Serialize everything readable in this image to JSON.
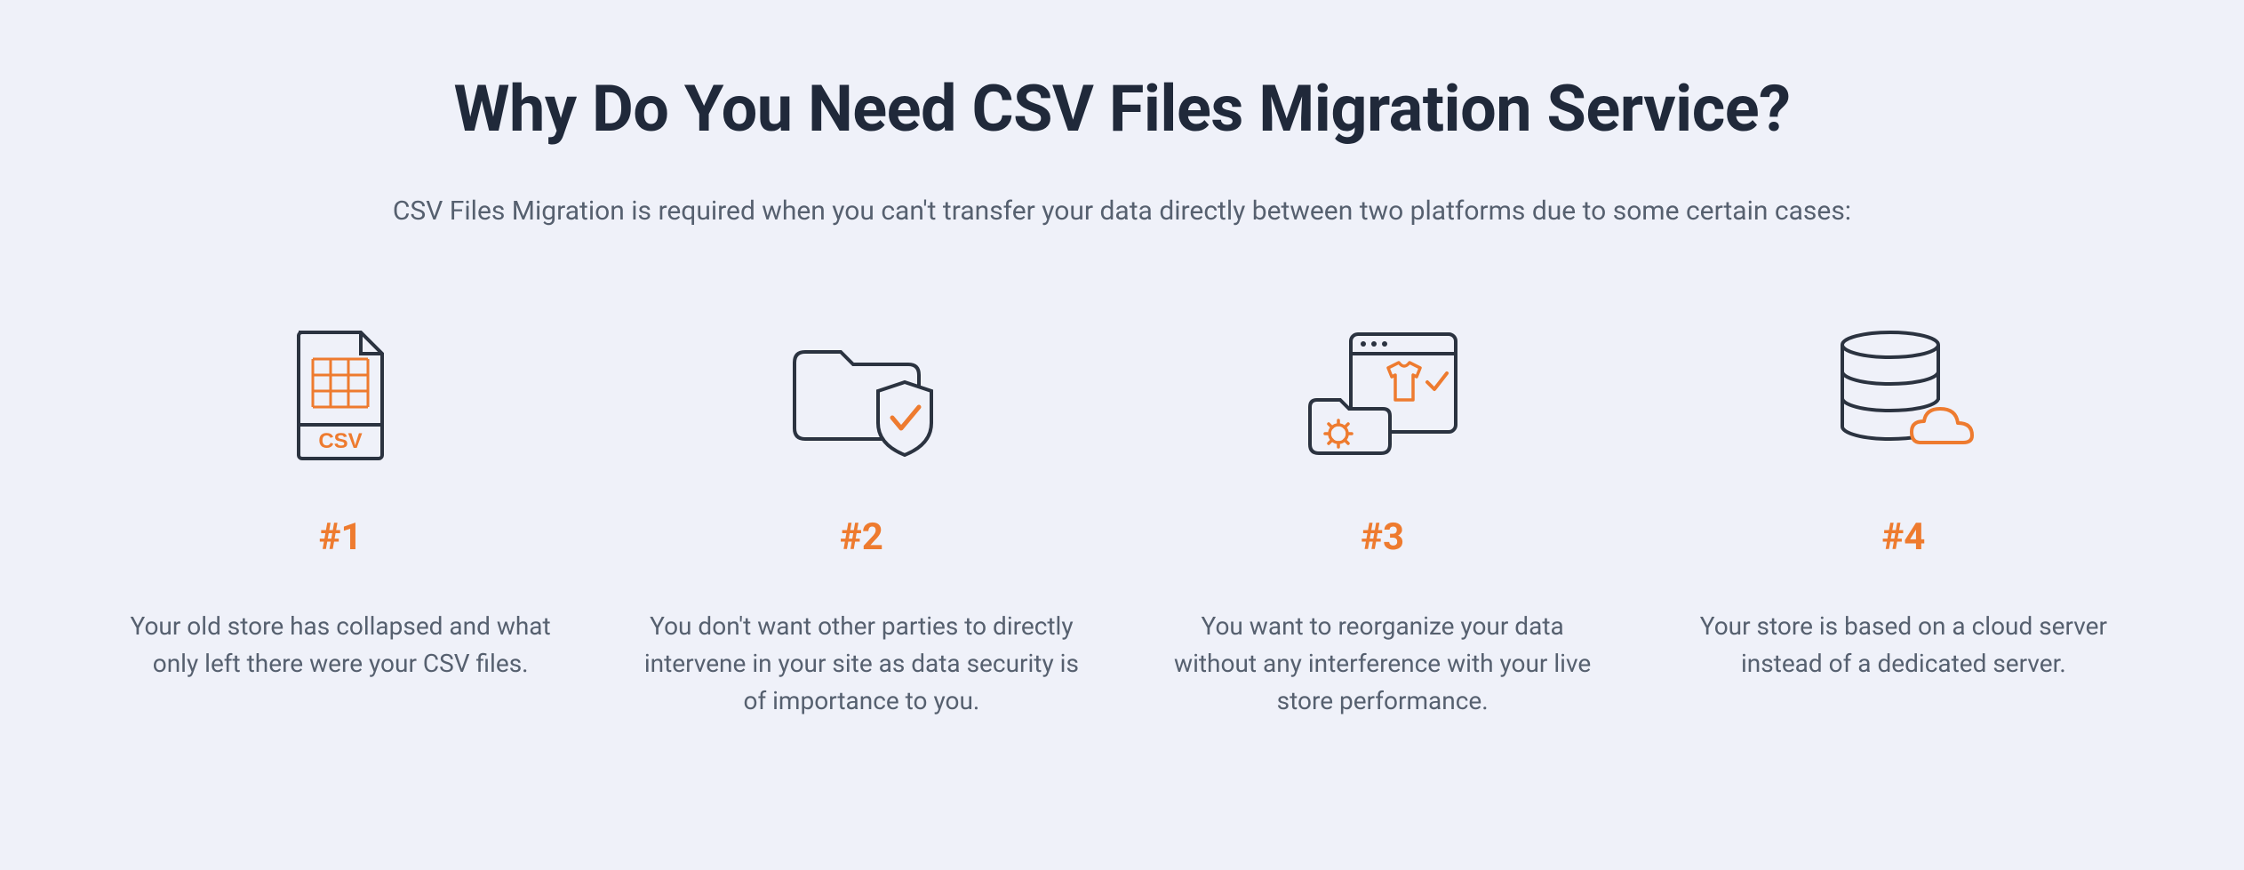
{
  "header": {
    "title": "Why Do You Need CSV Files Migration Service?",
    "subtitle": "CSV Files Migration is required when you can't transfer your data directly between two platforms due to some certain cases:"
  },
  "cards": [
    {
      "icon": "csv-file-icon",
      "number": "#1",
      "description": "Your old store has collapsed and what only left there were your CSV files."
    },
    {
      "icon": "folder-shield-icon",
      "number": "#2",
      "description": "You don't want other parties to directly intervene in your site as data security is of importance to you."
    },
    {
      "icon": "browser-folder-icon",
      "number": "#3",
      "description": "You want to reorganize your data without any interference with your live store performance."
    },
    {
      "icon": "database-cloud-icon",
      "number": "#4",
      "description": "Your store is based on a cloud server instead of a dedicated server."
    }
  ],
  "colors": {
    "accent": "#ee7b2f",
    "heading": "#20293a",
    "body": "#56606f",
    "background": "#eff1f9",
    "iconStroke": "#2b3340"
  }
}
